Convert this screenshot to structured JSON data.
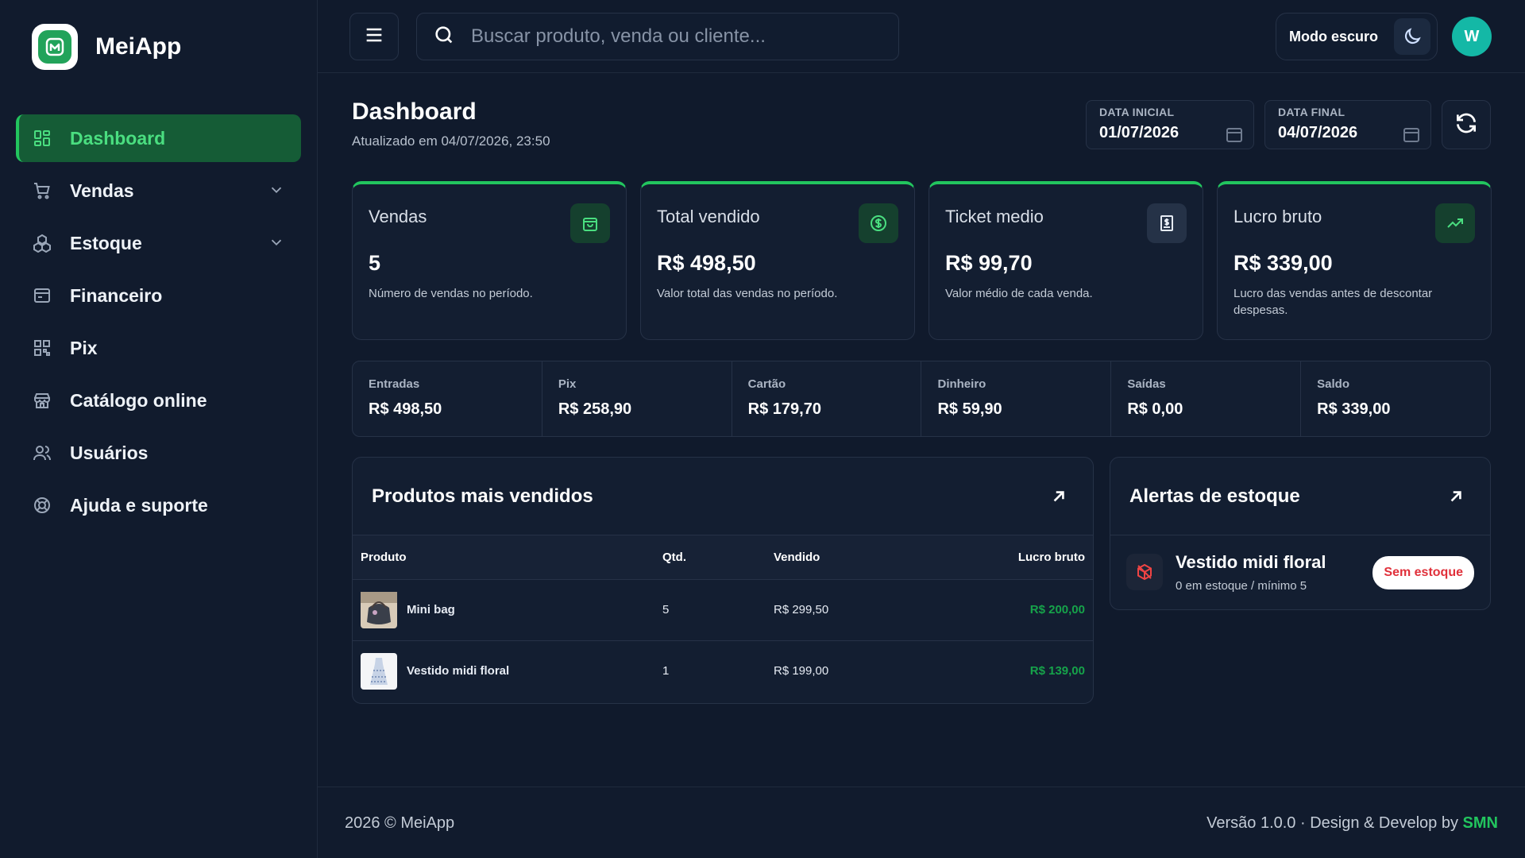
{
  "brand": {
    "name": "MeiApp"
  },
  "sidebar": {
    "items": [
      {
        "label": "Dashboard",
        "icon": "dashboard-grid-icon",
        "active": true
      },
      {
        "label": "Vendas",
        "icon": "cart-icon",
        "expandable": true
      },
      {
        "label": "Estoque",
        "icon": "boxes-icon",
        "expandable": true
      },
      {
        "label": "Financeiro",
        "icon": "wallet-icon"
      },
      {
        "label": "Pix",
        "icon": "qrcode-icon"
      },
      {
        "label": "Catálogo online",
        "icon": "store-icon"
      },
      {
        "label": "Usuários",
        "icon": "users-icon"
      },
      {
        "label": "Ajuda e suporte",
        "icon": "lifebuoy-icon"
      }
    ]
  },
  "topbar": {
    "search_placeholder": "Buscar produto, venda ou cliente...",
    "mode_label": "Modo escuro",
    "avatar_initial": "W"
  },
  "header": {
    "title": "Dashboard",
    "updated": "Atualizado em 04/07/2026, 23:50",
    "date_start_label": "DATA INICIAL",
    "date_start": "01/07/2026",
    "date_end_label": "DATA FINAL",
    "date_end": "04/07/2026"
  },
  "kpis": [
    {
      "title": "Vendas",
      "value": "5",
      "desc": "Número de vendas no período.",
      "icon": "shopping-bag-icon"
    },
    {
      "title": "Total vendido",
      "value": "R$ 498,50",
      "desc": "Valor total das vendas no período.",
      "icon": "dollar-circle-icon"
    },
    {
      "title": "Ticket medio",
      "value": "R$ 99,70",
      "desc": "Valor médio de cada venda.",
      "icon": "receipt-icon"
    },
    {
      "title": "Lucro bruto",
      "value": "R$ 339,00",
      "desc": "Lucro das vendas antes de descontar despesas.",
      "icon": "trending-up-icon"
    }
  ],
  "summary": [
    {
      "label": "Entradas",
      "value": "R$ 498,50"
    },
    {
      "label": "Pix",
      "value": "R$ 258,90"
    },
    {
      "label": "Cartão",
      "value": "R$ 179,70"
    },
    {
      "label": "Dinheiro",
      "value": "R$ 59,90"
    },
    {
      "label": "Saídas",
      "value": "R$ 0,00"
    },
    {
      "label": "Saldo",
      "value": "R$ 339,00"
    }
  ],
  "top_products": {
    "title": "Produtos mais vendidos",
    "columns": [
      "Produto",
      "Qtd.",
      "Vendido",
      "Lucro bruto"
    ],
    "rows": [
      {
        "product": "Mini bag",
        "qty": "5",
        "sold": "R$ 299,50",
        "profit": "R$ 200,00"
      },
      {
        "product": "Vestido midi floral",
        "qty": "1",
        "sold": "R$ 199,00",
        "profit": "R$ 139,00"
      }
    ]
  },
  "stock_alerts": {
    "title": "Alertas de estoque",
    "items": [
      {
        "name": "Vestido midi floral",
        "detail": "0 em estoque / mínimo 5",
        "badge": "Sem estoque"
      }
    ]
  },
  "footer": {
    "copyright": "2026 © MeiApp",
    "version_text": "Versão 1.0.0 · Design & Develop by",
    "credit": "SMN"
  },
  "colors": {
    "accent": "#22c55e",
    "background": "#101a2c",
    "danger": "#e0303a"
  }
}
